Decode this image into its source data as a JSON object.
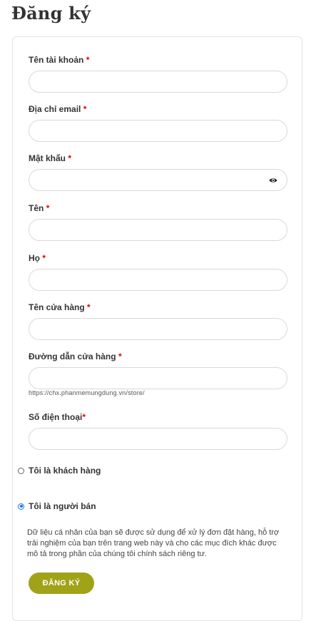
{
  "page": {
    "title": "Đăng ký"
  },
  "form": {
    "fields": [
      {
        "label": "Tên tài khoản",
        "required_mark": "*",
        "value": ""
      },
      {
        "label": "Địa chỉ email",
        "required_mark": "*",
        "value": ""
      },
      {
        "label": "Mật khẩu",
        "required_mark": "*",
        "value": "",
        "icon": "eye-icon"
      },
      {
        "label": "Tên",
        "required_mark": "*",
        "value": ""
      },
      {
        "label": "Họ",
        "required_mark": "*",
        "value": ""
      },
      {
        "label": "Tên cửa hàng",
        "required_mark": "*",
        "value": ""
      },
      {
        "label": "Đường dẫn cửa hàng",
        "required_mark": "*",
        "value": "",
        "hint": "https://chx.phanmemungdung.vn/store/"
      },
      {
        "label": "Số điện thoại",
        "required_mark": "*",
        "value": ""
      }
    ],
    "role_options": [
      {
        "label": "Tôi là khách hàng",
        "selected": false
      },
      {
        "label": "Tôi là người bán",
        "selected": true
      }
    ],
    "privacy_text": "Dữ liệu cá nhân của bạn sẽ được sử dụng để xử lý đơn đặt hàng, hỗ trợ trải nghiệm của bạn trên trang web này và cho các mục đích khác được mô tả trong phần của chúng tôi chính sách riêng tư.",
    "submit_label": "ĐĂNG KÝ"
  },
  "colors": {
    "required": "#e00000",
    "accent": "#a0a218",
    "radio": "#1a73e8"
  }
}
